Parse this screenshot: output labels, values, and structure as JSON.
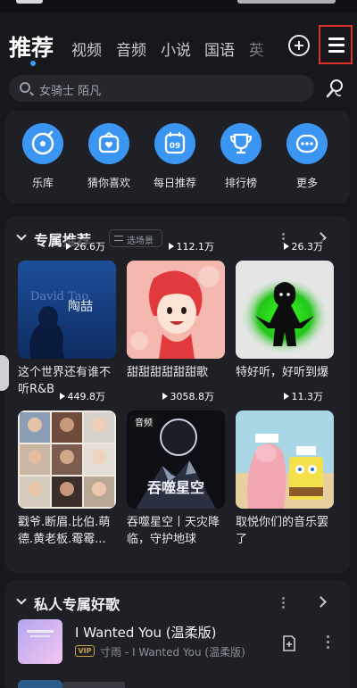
{
  "nav": {
    "active_tab": "推荐",
    "tabs": [
      "视频",
      "音频",
      "小说",
      "国语",
      "英"
    ]
  },
  "search": {
    "placeholder": "女骑士 陌凡"
  },
  "shortcuts": [
    {
      "label": "乐库",
      "icon": "music-library-icon"
    },
    {
      "label": "猜你喜欢",
      "icon": "radio-heart-icon"
    },
    {
      "label": "每日推荐",
      "icon": "calendar-icon",
      "day": "09"
    },
    {
      "label": "排行榜",
      "icon": "trophy-icon"
    },
    {
      "label": "更多",
      "icon": "more-dots-icon"
    }
  ],
  "section_exclusive": {
    "title": "专属推荐",
    "scene_label": "选场景",
    "playlists": [
      {
        "name": "这个世界还有谁不听R&B",
        "plays": "26.6万",
        "cover_text": "陶喆"
      },
      {
        "name": "甜甜甜甜甜甜歌",
        "plays": "112.1万"
      },
      {
        "name": "特好听，好听到爆",
        "plays": "26.3万"
      },
      {
        "name": "戳爷.断眉.比伯.萌德.黄老板.霉霉...",
        "plays": "449.8万"
      },
      {
        "name": "吞噬星空丨天灾降临，守护地球",
        "plays": "3058.8万",
        "tag": "音频",
        "cover_text": "吞噬星空"
      },
      {
        "name": "取悦你们的音乐罢了",
        "plays": "11.3万"
      }
    ]
  },
  "section_private": {
    "title": "私人专属好歌",
    "song": {
      "title": "I Wanted You (温柔版)",
      "vip": "VIP",
      "subtitle": "寸雨 - I Wanted You (温柔版)"
    }
  },
  "colors": {
    "background": "#17181c",
    "card": "#1f2025",
    "accent_blue": "#3a96f2",
    "highlight_red": "#e0302a"
  }
}
